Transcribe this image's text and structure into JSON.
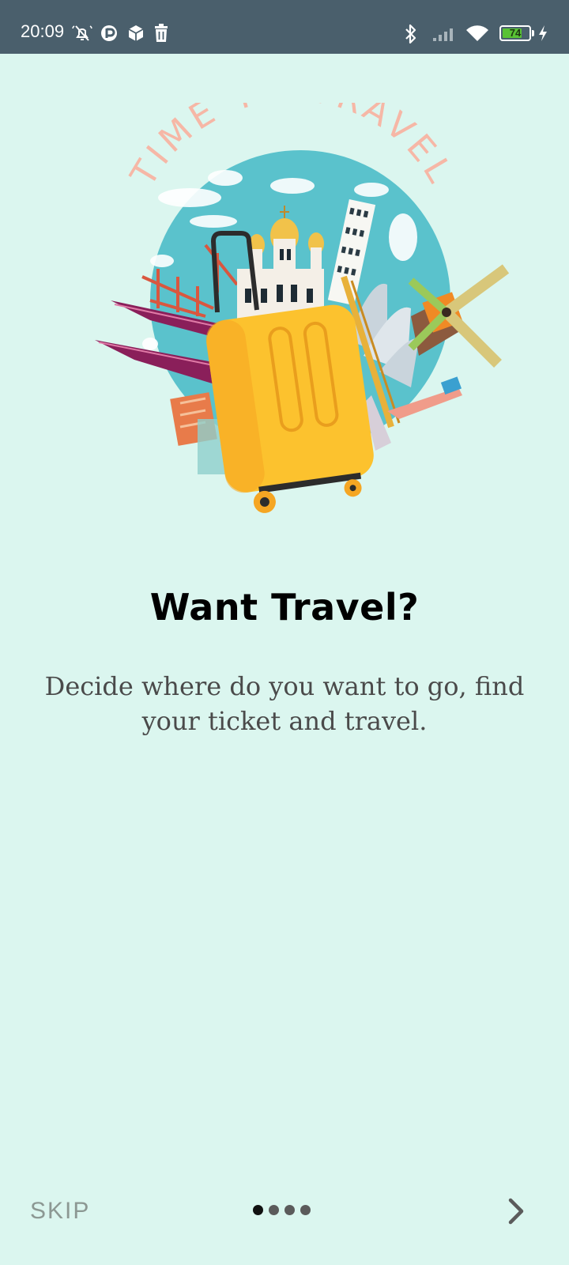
{
  "status_bar": {
    "time": "20:09",
    "battery_level": "74",
    "battery_fraction": 0.74,
    "charging": true,
    "icons": [
      "mute-alarm-icon",
      "app-notification-icon",
      "package-icon",
      "trash-icon",
      "bluetooth-icon",
      "signal-icon",
      "wifi-icon",
      "battery-icon",
      "charging-icon"
    ]
  },
  "illustration": {
    "arc_text": "TIME TO TRAVEL",
    "name": "travel-suitcase-globe"
  },
  "onboarding": {
    "title": "Want Travel?",
    "description": "Decide where do you want to go, find your ticket and travel."
  },
  "navigation": {
    "skip_label": "SKIP",
    "page_count": 4,
    "current_page": 1,
    "next_icon": "chevron-right-icon"
  },
  "colors": {
    "background": "#dbf6ef",
    "status_bar": "#4a5f6c",
    "globe": "#5ac2cc",
    "suitcase": "#fcc22e",
    "arc_text": "#f6b7a6",
    "skip_text": "#8c9893"
  }
}
